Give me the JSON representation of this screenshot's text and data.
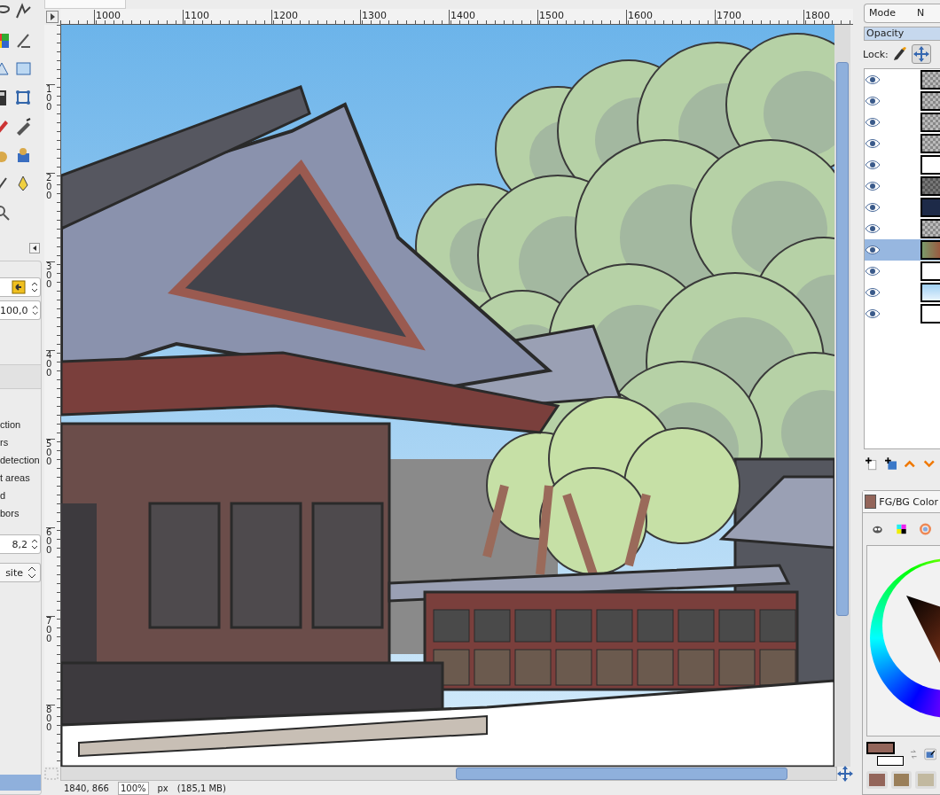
{
  "tool_options": {
    "spin_values": [
      "100,0",
      "8,2"
    ],
    "labels": [
      "ction",
      "rs",
      "detection",
      "t areas",
      "d",
      "bors"
    ],
    "dropdown": "site"
  },
  "ruler_top": {
    "ticks": [
      "1000",
      "1100",
      "1200",
      "1300",
      "1400",
      "1500",
      "1600",
      "1700",
      "1800"
    ]
  },
  "ruler_left": {
    "ticks": [
      "100",
      "200",
      "300",
      "400",
      "500",
      "600",
      "700",
      "800"
    ]
  },
  "status_bar": {
    "coords": "1840, 866",
    "zoom": "100%",
    "unit": "px",
    "info": "(185,1 MB)"
  },
  "layers": {
    "mode_label": "Mode",
    "mode_value": "N",
    "opacity": {
      "label": "Opacity",
      "level": 1.0
    },
    "lock_label": "Lock:",
    "items": [
      {
        "visible": true,
        "selected": false,
        "kind": "transparent"
      },
      {
        "visible": true,
        "selected": false,
        "kind": "transparent"
      },
      {
        "visible": true,
        "selected": false,
        "kind": "transparent"
      },
      {
        "visible": true,
        "selected": false,
        "kind": "transparent"
      },
      {
        "visible": true,
        "selected": false,
        "kind": "white"
      },
      {
        "visible": true,
        "selected": false,
        "kind": "grey"
      },
      {
        "visible": true,
        "selected": false,
        "kind": "dark"
      },
      {
        "visible": true,
        "selected": false,
        "kind": "transparent"
      },
      {
        "visible": true,
        "selected": true,
        "kind": "photo"
      },
      {
        "visible": true,
        "selected": false,
        "kind": "white"
      },
      {
        "visible": true,
        "selected": false,
        "kind": "sky"
      },
      {
        "visible": true,
        "selected": false,
        "kind": "white"
      }
    ]
  },
  "colors": {
    "tab_label": "FG/BG Color",
    "foreground": {
      "color": "#93655a"
    },
    "swatches": [
      {
        "color": "#93655a"
      },
      {
        "color": "#9a7f5a"
      },
      {
        "color": "#c2b9a0"
      }
    ]
  }
}
